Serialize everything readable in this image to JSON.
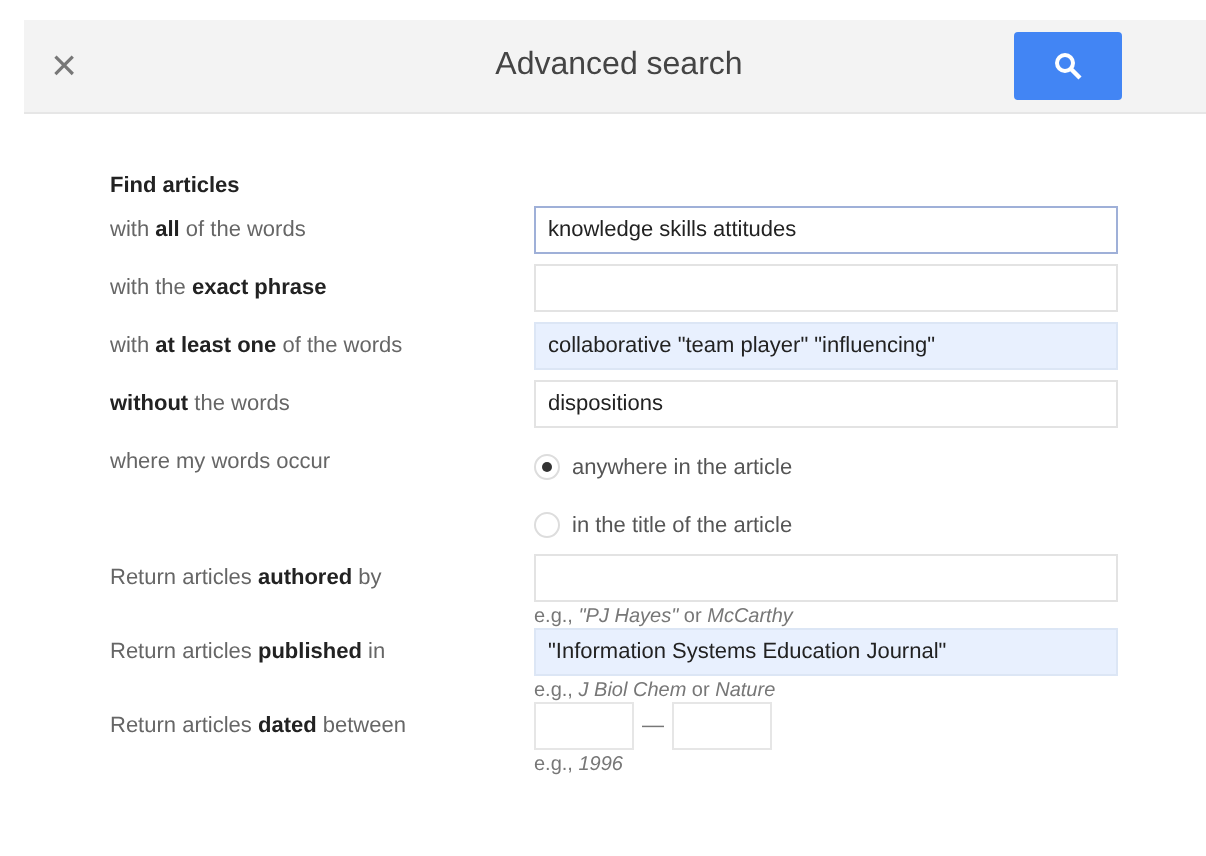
{
  "header": {
    "close": "×",
    "title": "Advanced search"
  },
  "section_title": "Find articles",
  "rows": [
    {
      "kind": "text",
      "label": "with **all** of the words",
      "value": "knowledge skills attitudes",
      "focused": true,
      "autofilled": false
    },
    {
      "kind": "text",
      "label": "with the **exact phrase**",
      "focused": false,
      "autofilled": false
    },
    {
      "kind": "text",
      "label": "with **at least one** of the words",
      "value": "collaborative \"team player\" \"influencing\"",
      "focused": false,
      "autofilled": true
    },
    {
      "kind": "text",
      "label": "**without** the words",
      "value": "dispositions",
      "focused": false,
      "autofilled": false
    },
    {
      "kind": "radio",
      "label": "where my words occur",
      "options": [
        {
          "label": "anywhere in the article",
          "selected": true
        },
        {
          "label": "in the title of the article",
          "selected": false
        }
      ]
    },
    {
      "kind": "text",
      "label": "Return articles **authored** by",
      "hint": "e.g., *\"PJ Hayes\"* or *McCarthy*",
      "focused": false,
      "autofilled": false
    },
    {
      "kind": "text",
      "label": "Return articles **published** in",
      "value": "\"Information Systems Education Journal\"",
      "hint": "e.g., *J Biol Chem* or *Nature*",
      "focused": false,
      "autofilled": true
    },
    {
      "kind": "date",
      "label": "Return articles **dated** between",
      "separator": "—",
      "hint": "e.g., *1996*"
    }
  ]
}
